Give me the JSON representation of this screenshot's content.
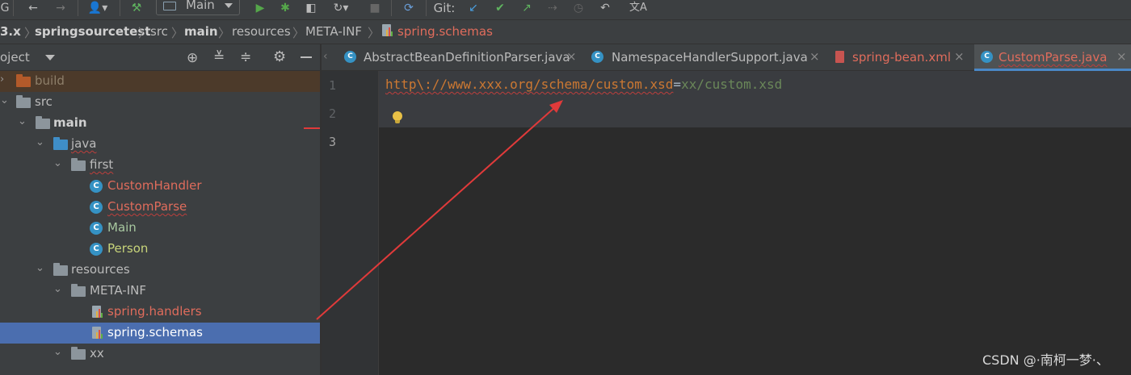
{
  "toolbar": {
    "run_config": "Main",
    "git_label": "Git:"
  },
  "breadcrumb": [
    "3.x",
    "springsourcetest",
    "src",
    "main",
    "resources",
    "META-INF",
    "spring.schemas"
  ],
  "project_panel": {
    "title": "oject"
  },
  "tree": [
    {
      "label": "build",
      "type": "folder-excluded"
    },
    {
      "label": "src",
      "type": "folder"
    },
    {
      "label": "main",
      "type": "module"
    },
    {
      "label": "java",
      "type": "source-folder"
    },
    {
      "label": "first",
      "type": "package"
    },
    {
      "label": "CustomHandler",
      "type": "class"
    },
    {
      "label": "CustomParse",
      "type": "class"
    },
    {
      "label": "Main",
      "type": "class-main"
    },
    {
      "label": "Person",
      "type": "class"
    },
    {
      "label": "resources",
      "type": "resources-folder"
    },
    {
      "label": "META-INF",
      "type": "folder"
    },
    {
      "label": "spring.handlers",
      "type": "properties-file"
    },
    {
      "label": "spring.schemas",
      "type": "properties-file"
    },
    {
      "label": "xx",
      "type": "folder"
    }
  ],
  "tabs": [
    {
      "label": "AbstractBeanDefinitionParser.java",
      "icon": "class-icon"
    },
    {
      "label": "NamespaceHandlerSupport.java",
      "icon": "class-icon"
    },
    {
      "label": "spring-bean.xml",
      "icon": "xml-icon"
    },
    {
      "label": "CustomParse.java",
      "icon": "class-icon"
    }
  ],
  "editor": {
    "line_numbers": [
      "1",
      "2",
      "3"
    ],
    "code_key": "http\\://www.xxx.org/schema/custom.xsd",
    "code_eq": "=",
    "code_value": "xx/custom.xsd"
  },
  "watermark": "CSDN @·南柯一梦·、",
  "colors": {
    "accent": "#4a88c7",
    "selection": "#4b6eaf",
    "error_text": "#e06c5c",
    "arrow": "#e03a3a"
  }
}
